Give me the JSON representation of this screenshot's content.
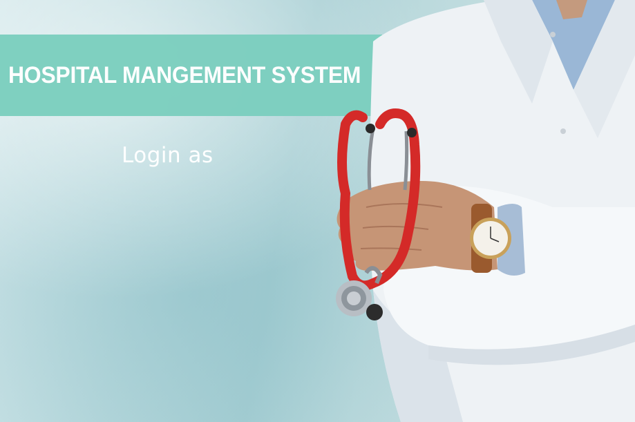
{
  "banner": {
    "title": "HOSPITAL MANGEMENT SYSTEM"
  },
  "login": {
    "prompt": "Login as"
  },
  "colors": {
    "banner_bg": "#7ccfbf",
    "text": "#ffffff",
    "background": "#b9d9dd",
    "stethoscope": "#d42a28",
    "coat": "#f2f5f7"
  },
  "illustration": {
    "subject": "doctor-with-stethoscope"
  }
}
